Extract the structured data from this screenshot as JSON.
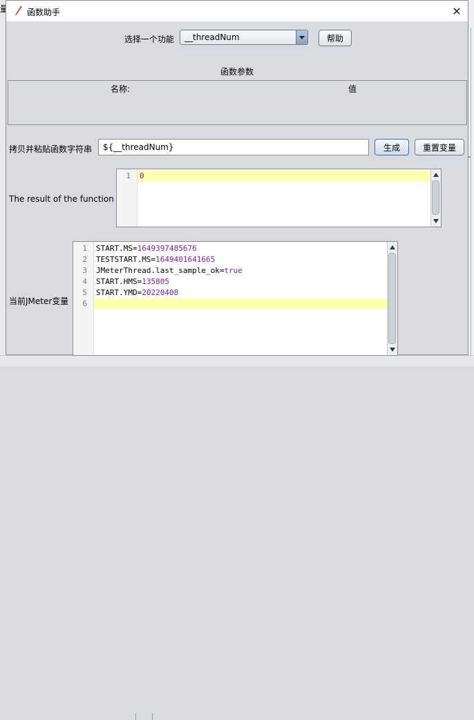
{
  "background": {
    "left_char": "量",
    "right_char": "-"
  },
  "dialog": {
    "title": "函数助手",
    "close_symbol": "✕"
  },
  "function_select": {
    "label": "选择一个功能",
    "value": "__threadNum",
    "help_label": "帮助"
  },
  "params": {
    "section_label": "函数参数",
    "name_header": "名称:",
    "value_header": "值"
  },
  "copy_paste": {
    "label": "拷贝并粘贴函数字符串",
    "value": "${__threadNum}",
    "generate_label": "生成",
    "reset_label": "重置变量"
  },
  "result": {
    "label": "The result of the function is",
    "lines": [
      {
        "num": "1",
        "text": "0"
      }
    ]
  },
  "variables": {
    "label": "当前JMeter变量",
    "lines": [
      {
        "num": "1",
        "key": "START.MS",
        "value": "1649397485676"
      },
      {
        "num": "2",
        "key": "TESTSTART.MS",
        "value": "1649401641665"
      },
      {
        "num": "3",
        "key": "JMeterThread.last_sample_ok",
        "value": "true"
      },
      {
        "num": "4",
        "key": "START.HMS",
        "value": "135805"
      },
      {
        "num": "5",
        "key": "START.YMD",
        "value": "20220408"
      },
      {
        "num": "6",
        "key": "",
        "value": ""
      }
    ]
  },
  "colors": {
    "dialog_bg": "#d9dbe0",
    "current_line_highlight": "#ffffb0",
    "value_text": "#7a1fa2"
  }
}
